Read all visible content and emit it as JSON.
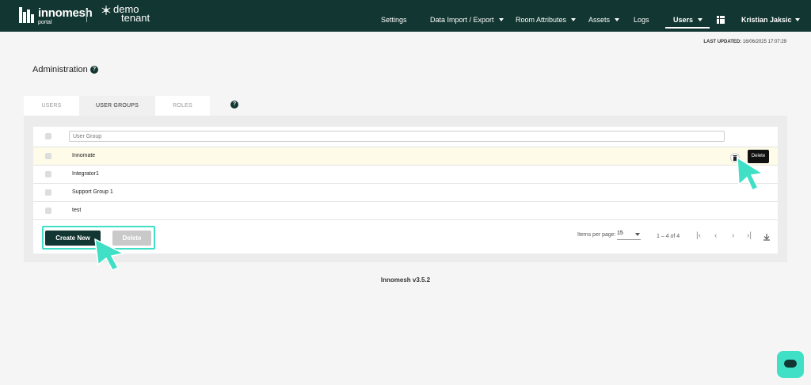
{
  "header": {
    "brand": "innomesh",
    "brand_sub": "portal",
    "tenant_line1": "demo",
    "tenant_line2": "tenant",
    "nav": [
      {
        "label": "Settings"
      },
      {
        "label": "Data Import / Export"
      },
      {
        "label": "Room Attributes"
      },
      {
        "label": "Assets"
      },
      {
        "label": "Logs"
      },
      {
        "label": "Users"
      },
      {
        "label": "Kristian Jaksic"
      }
    ],
    "bg_color": "#123631"
  },
  "last_updated": {
    "label": "LAST UPDATED:",
    "value": "16/06/2025 17:07:29"
  },
  "page": {
    "title": "Administration",
    "help": "?"
  },
  "tabs": [
    {
      "label": "USERS"
    },
    {
      "label": "USER GROUPS"
    },
    {
      "label": "ROLES"
    }
  ],
  "table": {
    "filter_placeholder": "User Group",
    "rows": [
      {
        "name": "Innomate"
      },
      {
        "name": "Integrator1"
      },
      {
        "name": "Support Group 1"
      },
      {
        "name": "test"
      }
    ],
    "row_delete_tooltip": "Delete",
    "row_delete_icon": "trash-icon"
  },
  "actions": {
    "create_label": "Create New",
    "delete_label": "Delete",
    "highlight_color": "#3fe0c5"
  },
  "pagination": {
    "items_per_page_label": "Items per page:",
    "items_per_page": "15",
    "range": "1 – 4 of 4"
  },
  "footer": {
    "version": "Innomesh v3.5.2"
  }
}
